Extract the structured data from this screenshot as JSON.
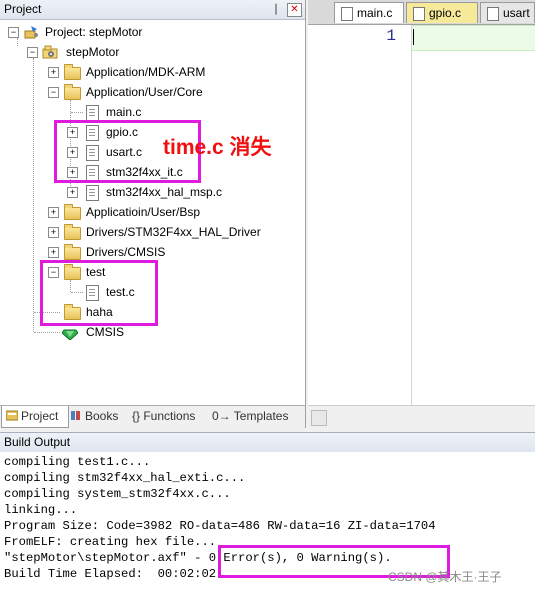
{
  "project_panel": {
    "title": "Project",
    "pin_glyph": "❘",
    "close_glyph": "✕",
    "tree": {
      "root": "Project: stepMotor",
      "target": "stepMotor",
      "groups": [
        {
          "label": "Application/MDK-ARM"
        },
        {
          "label": "Application/User/Core"
        },
        {
          "label": "main.c"
        },
        {
          "label": "gpio.c"
        },
        {
          "label": "usart.c"
        },
        {
          "label": "stm32f4xx_it.c"
        },
        {
          "label": "stm32f4xx_hal_msp.c"
        },
        {
          "label": "Applicatioin/User/Bsp"
        },
        {
          "label": "Drivers/STM32F4xx_HAL_Driver"
        },
        {
          "label": "Drivers/CMSIS"
        },
        {
          "label": "test"
        },
        {
          "label": "test.c"
        },
        {
          "label": "haha"
        },
        {
          "label": "CMSIS"
        }
      ]
    },
    "annotation": "time.c 消失",
    "tabs": [
      {
        "label": "Project",
        "icon": "project-icon"
      },
      {
        "label": "Books",
        "icon": "books-icon"
      },
      {
        "label": "{} Functions",
        "icon": "functions-icon"
      },
      {
        "label": "0→ Templates",
        "icon": "templates-icon"
      }
    ]
  },
  "editor": {
    "tabs": [
      {
        "label": "main.c"
      },
      {
        "label": "gpio.c"
      },
      {
        "label": "usart"
      }
    ],
    "line_number": "1"
  },
  "build_output": {
    "title": "Build Output",
    "lines": [
      "compiling test1.c...",
      "compiling stm32f4xx_hal_exti.c...",
      "compiling system_stm32f4xx.c...",
      "linking...",
      "Program Size: Code=3982 RO-data=486 RW-data=16 ZI-data=1704",
      "FromELF: creating hex file...",
      "\"stepMotor\\stepMotor.axf\" - 0 Error(s), 0 Warning(s).",
      "Build Time Elapsed:  00:02:02"
    ],
    "watermark": "CSDN @其木王·王子"
  }
}
